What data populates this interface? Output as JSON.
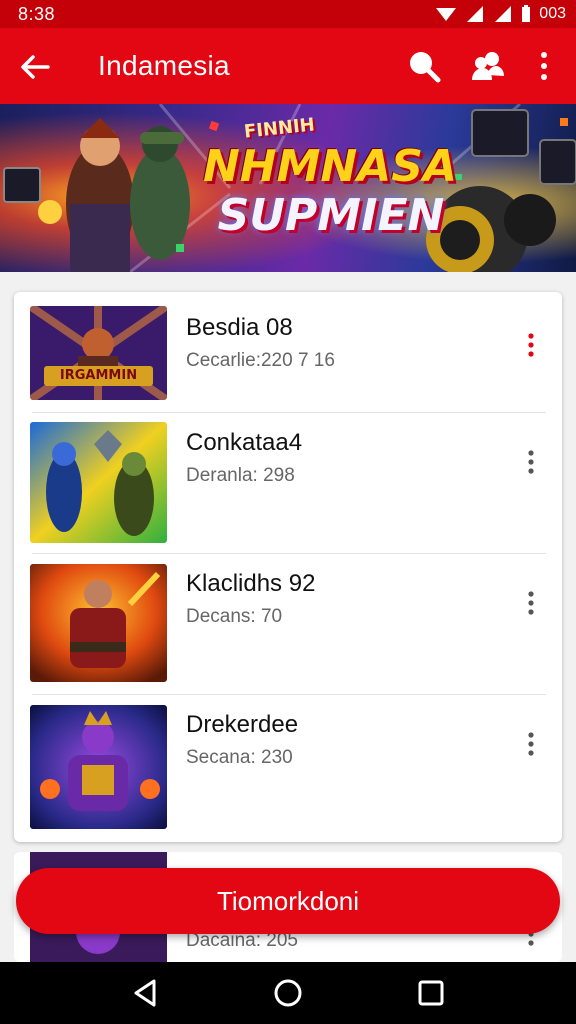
{
  "status_bar": {
    "time": "8:38",
    "battery_text": "003"
  },
  "app_bar": {
    "title": "Indamesia"
  },
  "banner": {
    "tag": "FINNIH",
    "title_line1": "NHMNASA",
    "title_line2": "SUPMIEN"
  },
  "list": {
    "items": [
      {
        "title": "Besdia 08",
        "subtitle": "Cecarlie:220 7 16",
        "thumb_caption": "IRGAMMIN",
        "accent": "#e30613"
      },
      {
        "title": "Conkataa4",
        "subtitle": "Deranla: 298",
        "thumb_caption": "",
        "accent": "#555555"
      },
      {
        "title": "Klaclidhs 92",
        "subtitle": "Decans: 70",
        "thumb_caption": "",
        "accent": "#555555"
      },
      {
        "title": "Drekerdee",
        "subtitle": "Secana: 230",
        "thumb_caption": "",
        "accent": "#555555"
      }
    ],
    "peek_item": {
      "subtitle": "Dacaina: 205"
    }
  },
  "fab": {
    "label": "Tiomorkdoni"
  },
  "colors": {
    "primary": "#e30613",
    "status_bar": "#c40008"
  }
}
